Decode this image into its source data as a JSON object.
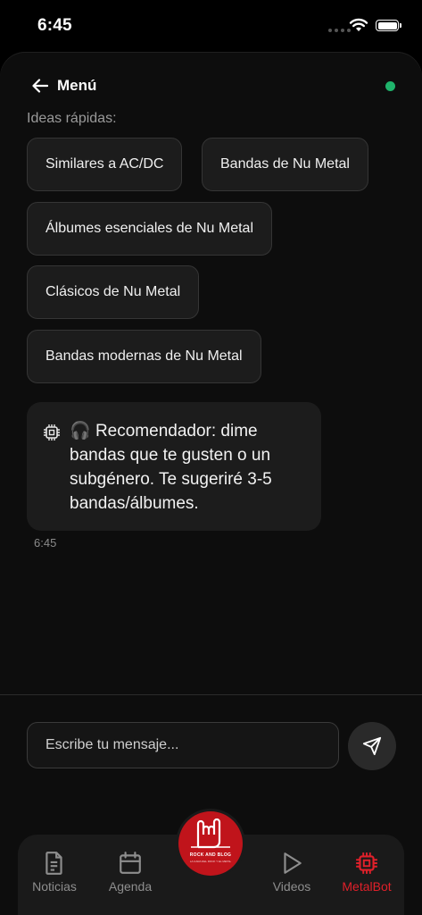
{
  "status_bar": {
    "time": "6:45"
  },
  "header": {
    "back_label": "Menú"
  },
  "quick_ideas": {
    "label": "Ideas rápidas:",
    "chips": [
      "Similares a AC/DC",
      "Bandas de Nu Metal",
      "Álbumes esenciales de Nu Metal",
      "Clásicos de Nu Metal",
      "Bandas modernas de Nu Metal"
    ]
  },
  "message": {
    "emoji": "🎧",
    "text": "Recomendador: dime bandas que te gusten o un subgénero. Te sugeriré 3-5 bandas/álbumes.",
    "time": "6:45"
  },
  "composer": {
    "placeholder": "Escribe tu mensaje..."
  },
  "logo": {
    "text": "ROCK AND BLOG",
    "subtext": "LA CARA DEL ROCK Y EL METAL"
  },
  "tabs": [
    {
      "label": "Noticias",
      "icon": "document-icon"
    },
    {
      "label": "Agenda",
      "icon": "calendar-icon"
    },
    {
      "label": "Videos",
      "icon": "play-icon"
    },
    {
      "label": "MetalBot",
      "icon": "chip-icon"
    }
  ],
  "colors": {
    "accent": "#e0202a",
    "online": "#1fb36b",
    "background": "#0d0d0d"
  }
}
